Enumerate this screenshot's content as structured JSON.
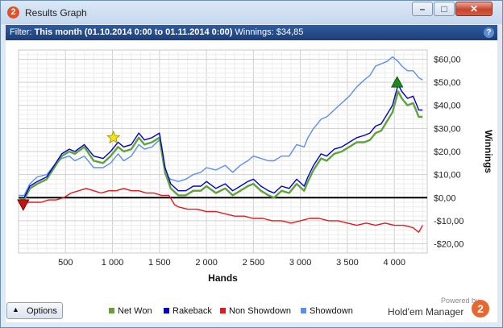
{
  "window": {
    "title": "Results Graph",
    "app_icon": "2",
    "minimize": "–",
    "maximize": "□",
    "close": "✕"
  },
  "filter": {
    "label": "Filter:",
    "text": "This month (01.10.2014 0:00 to 01.11.2014 0:00)",
    "winnings": "Winnings: $34,85",
    "help": "?"
  },
  "footer": {
    "options_label": "Options",
    "powered_by": "Powered by",
    "brand": "Hold'em Manager",
    "brand_logo": "2"
  },
  "legend": [
    {
      "label": "Net Won",
      "color": "#5fa33a"
    },
    {
      "label": "Rakeback",
      "color": "#0000cc"
    },
    {
      "label": "Non Showdown",
      "color": "#e31a1c"
    },
    {
      "label": "Showdown",
      "color": "#5b8ff0"
    }
  ],
  "chart_data": {
    "type": "line",
    "xlabel": "Hands",
    "ylabel": "Winnings",
    "xlim": [
      0,
      4350
    ],
    "ylim": [
      -24,
      64
    ],
    "x_ticks": [
      500,
      1000,
      1500,
      2000,
      2500,
      3000,
      3500,
      4000
    ],
    "x_tick_labels": [
      "500",
      "1 000",
      "1 500",
      "2 000",
      "2 500",
      "3 000",
      "3 500",
      "4 000"
    ],
    "y_ticks": [
      -20,
      -10,
      0,
      10,
      20,
      30,
      40,
      50,
      60
    ],
    "y_tick_labels": [
      "-$20,00",
      "-$10,00",
      "$0,00",
      "$10,00",
      "$20,00",
      "$30,00",
      "$40,00",
      "$50,00",
      "$60,00"
    ],
    "grid": true,
    "zero_line": true,
    "markers": [
      {
        "kind": "low",
        "x": 50,
        "y": -3,
        "color": "#cc1111"
      },
      {
        "kind": "star",
        "x": 1010,
        "y": 26,
        "color": "#f2e21a"
      },
      {
        "kind": "high",
        "x": 4030,
        "y": 50,
        "color": "#1a8a1a"
      }
    ],
    "series": [
      {
        "name": "Net Won",
        "color": "#5fa33a",
        "x": [
          0,
          60,
          120,
          200,
          300,
          380,
          460,
          540,
          600,
          700,
          800,
          900,
          980,
          1060,
          1120,
          1200,
          1280,
          1340,
          1420,
          1500,
          1560,
          1620,
          1700,
          1780,
          1860,
          1940,
          2000,
          2100,
          2200,
          2280,
          2360,
          2440,
          2500,
          2580,
          2660,
          2720,
          2800,
          2880,
          2960,
          3040,
          3080,
          3140,
          3220,
          3280,
          3360,
          3440,
          3520,
          3600,
          3680,
          3740,
          3800,
          3860,
          3920,
          3980,
          4040,
          4080,
          4140,
          4200,
          4260,
          4300
        ],
        "y": [
          0,
          -1,
          4,
          6,
          8,
          13,
          18,
          20,
          19,
          22,
          16,
          15,
          18,
          22,
          20,
          21,
          26,
          23,
          24,
          26,
          11,
          4,
          1,
          1,
          3,
          3,
          5,
          2,
          4,
          1,
          3,
          5,
          6,
          3,
          1,
          0,
          3,
          2,
          6,
          3,
          7,
          12,
          17,
          16,
          19,
          20,
          22,
          24,
          24,
          25,
          28,
          29,
          33,
          37,
          46,
          43,
          40,
          41,
          35,
          35
        ]
      },
      {
        "name": "Rakeback",
        "color": "#0000cc",
        "x": [
          0,
          60,
          120,
          200,
          300,
          380,
          460,
          540,
          600,
          700,
          800,
          900,
          980,
          1060,
          1120,
          1200,
          1280,
          1340,
          1420,
          1500,
          1560,
          1620,
          1700,
          1780,
          1860,
          1940,
          2000,
          2100,
          2200,
          2280,
          2360,
          2440,
          2500,
          2580,
          2660,
          2720,
          2800,
          2880,
          2960,
          3040,
          3080,
          3140,
          3220,
          3280,
          3360,
          3440,
          3520,
          3600,
          3680,
          3740,
          3800,
          3860,
          3920,
          3980,
          4040,
          4080,
          4140,
          4200,
          4260,
          4300
        ],
        "y": [
          0,
          0,
          5,
          7,
          9,
          14,
          19,
          21,
          20,
          23,
          18,
          17,
          20,
          24,
          22,
          23,
          28,
          25,
          26,
          28,
          13,
          6,
          3,
          3,
          5,
          5,
          7,
          4,
          6,
          3,
          5,
          7,
          8,
          5,
          3,
          2,
          5,
          4,
          8,
          5,
          9,
          14,
          19,
          18,
          21,
          22,
          24,
          26,
          27,
          28,
          31,
          32,
          36,
          40,
          49,
          46,
          43,
          44,
          38,
          38
        ]
      },
      {
        "name": "Non Showdown",
        "color": "#e31a1c",
        "x": [
          0,
          80,
          160,
          240,
          320,
          400,
          480,
          560,
          640,
          720,
          800,
          880,
          960,
          1040,
          1120,
          1200,
          1280,
          1360,
          1440,
          1520,
          1600,
          1660,
          1700,
          1800,
          1900,
          2000,
          2100,
          2200,
          2300,
          2400,
          2500,
          2600,
          2700,
          2800,
          2900,
          3000,
          3100,
          3200,
          3300,
          3400,
          3500,
          3600,
          3700,
          3800,
          3900,
          4000,
          4100,
          4200,
          4260,
          4300
        ],
        "y": [
          -1,
          -2,
          -2,
          -2,
          -1,
          -1,
          0,
          2,
          3,
          4,
          3,
          2,
          3,
          3,
          4,
          3,
          3,
          2,
          2,
          1,
          1,
          -3,
          -4,
          -5,
          -5,
          -6,
          -6,
          -7,
          -8,
          -8,
          -9,
          -9,
          -10,
          -10,
          -11,
          -10,
          -9,
          -9,
          -10,
          -10,
          -11,
          -12,
          -11,
          -12,
          -11,
          -12,
          -12,
          -13,
          -15,
          -12
        ]
      },
      {
        "name": "Showdown",
        "color": "#5b8ff0",
        "x": [
          0,
          60,
          120,
          200,
          300,
          380,
          460,
          540,
          600,
          700,
          800,
          900,
          980,
          1060,
          1120,
          1200,
          1280,
          1340,
          1420,
          1500,
          1560,
          1620,
          1700,
          1780,
          1860,
          1940,
          2000,
          2100,
          2200,
          2280,
          2360,
          2440,
          2500,
          2580,
          2660,
          2720,
          2800,
          2880,
          2960,
          3040,
          3080,
          3140,
          3220,
          3280,
          3360,
          3440,
          3520,
          3600,
          3680,
          3740,
          3800,
          3860,
          3920,
          3980,
          4040,
          4080,
          4140,
          4200,
          4260,
          4300
        ],
        "y": [
          1,
          1,
          6,
          9,
          10,
          14,
          17,
          18,
          16,
          18,
          13,
          13,
          15,
          19,
          16,
          18,
          23,
          21,
          22,
          25,
          10,
          8,
          7,
          8,
          10,
          11,
          13,
          12,
          14,
          11,
          14,
          16,
          18,
          17,
          16,
          16,
          18,
          18,
          23,
          22,
          26,
          30,
          34,
          35,
          38,
          41,
          44,
          48,
          51,
          53,
          57,
          58,
          59,
          61,
          59,
          57,
          55,
          55,
          52,
          51
        ]
      }
    ]
  }
}
